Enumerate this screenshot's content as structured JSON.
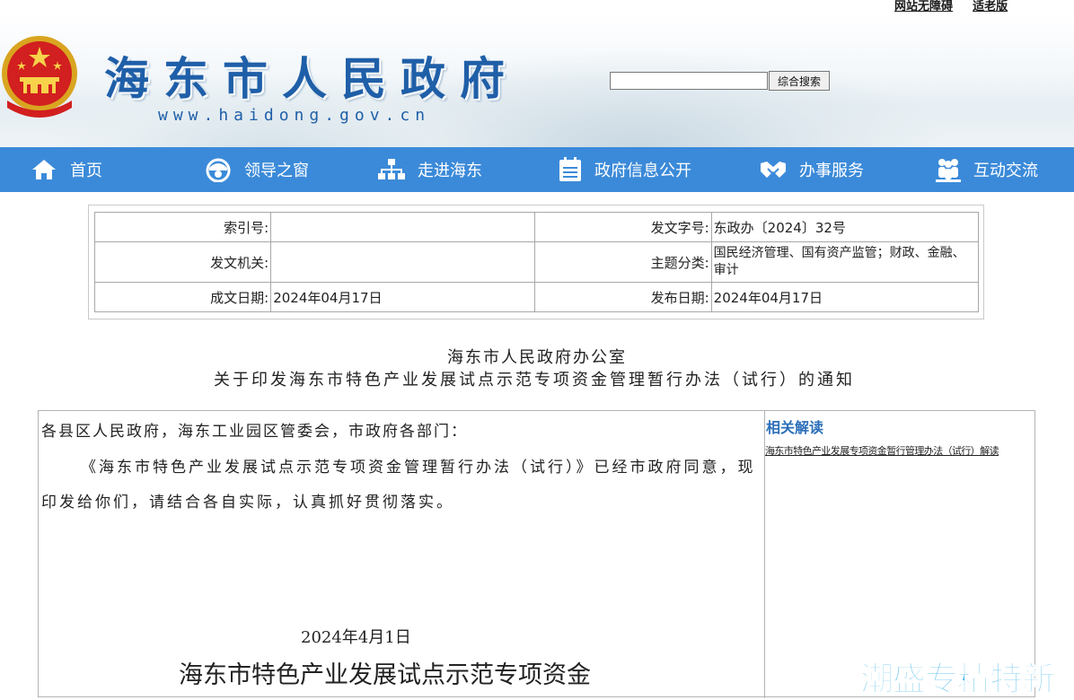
{
  "top_links": {
    "accessibility": "网站无障碍",
    "elder": "适老版"
  },
  "header": {
    "title": "海东市人民政府",
    "url": "www.haidong.gov.cn",
    "search_button": "综合搜索",
    "search_value": ""
  },
  "nav": [
    {
      "label": "首页",
      "icon": "home-icon"
    },
    {
      "label": "领导之窗",
      "icon": "leader-icon"
    },
    {
      "label": "走进海东",
      "icon": "org-icon"
    },
    {
      "label": "政府信息公开",
      "icon": "document-icon"
    },
    {
      "label": "办事服务",
      "icon": "handshake-icon"
    },
    {
      "label": "互动交流",
      "icon": "people-icon"
    }
  ],
  "info": {
    "index_label": "索引号:",
    "index_value": "",
    "doc_no_label": "发文字号:",
    "doc_no_value": "东政办〔2024〕32号",
    "issuer_label": "发文机关:",
    "issuer_value": "",
    "topic_label": "主题分类:",
    "topic_value": "国民经济管理、国有资产监管；财政、金融、审计",
    "made_date_label": "成文日期:",
    "made_date_value": "2024年04月17日",
    "publish_date_label": "发布日期:",
    "publish_date_value": "2024年04月17日"
  },
  "document": {
    "heading_line1": "海东市人民政府办公室",
    "heading_line2": "关于印发海东市特色产业发展试点示范专项资金管理暂行办法（试行）的通知",
    "addressee": "各县区人民政府，海东工业园区管委会，市政府各部门：",
    "body": "《海东市特色产业发展试点示范专项资金管理暂行办法（试行）》已经市政府同意，现印发给你们，请结合各自实际，认真抓好贯彻落实。",
    "date": "2024年4月1日",
    "attachment_title": "海东市特色产业发展试点示范专项资金"
  },
  "sidebar": {
    "title": "相关解读",
    "link": "海东市特色产业发展专项资金暂行管理办法（试行）解读"
  },
  "watermark": "潮盛专精特新",
  "colors": {
    "nav_bg": "#3b8ad9",
    "title_blue": "#1f5fa8",
    "side_title": "#2d6fb8",
    "watermark": "#55bdea"
  }
}
